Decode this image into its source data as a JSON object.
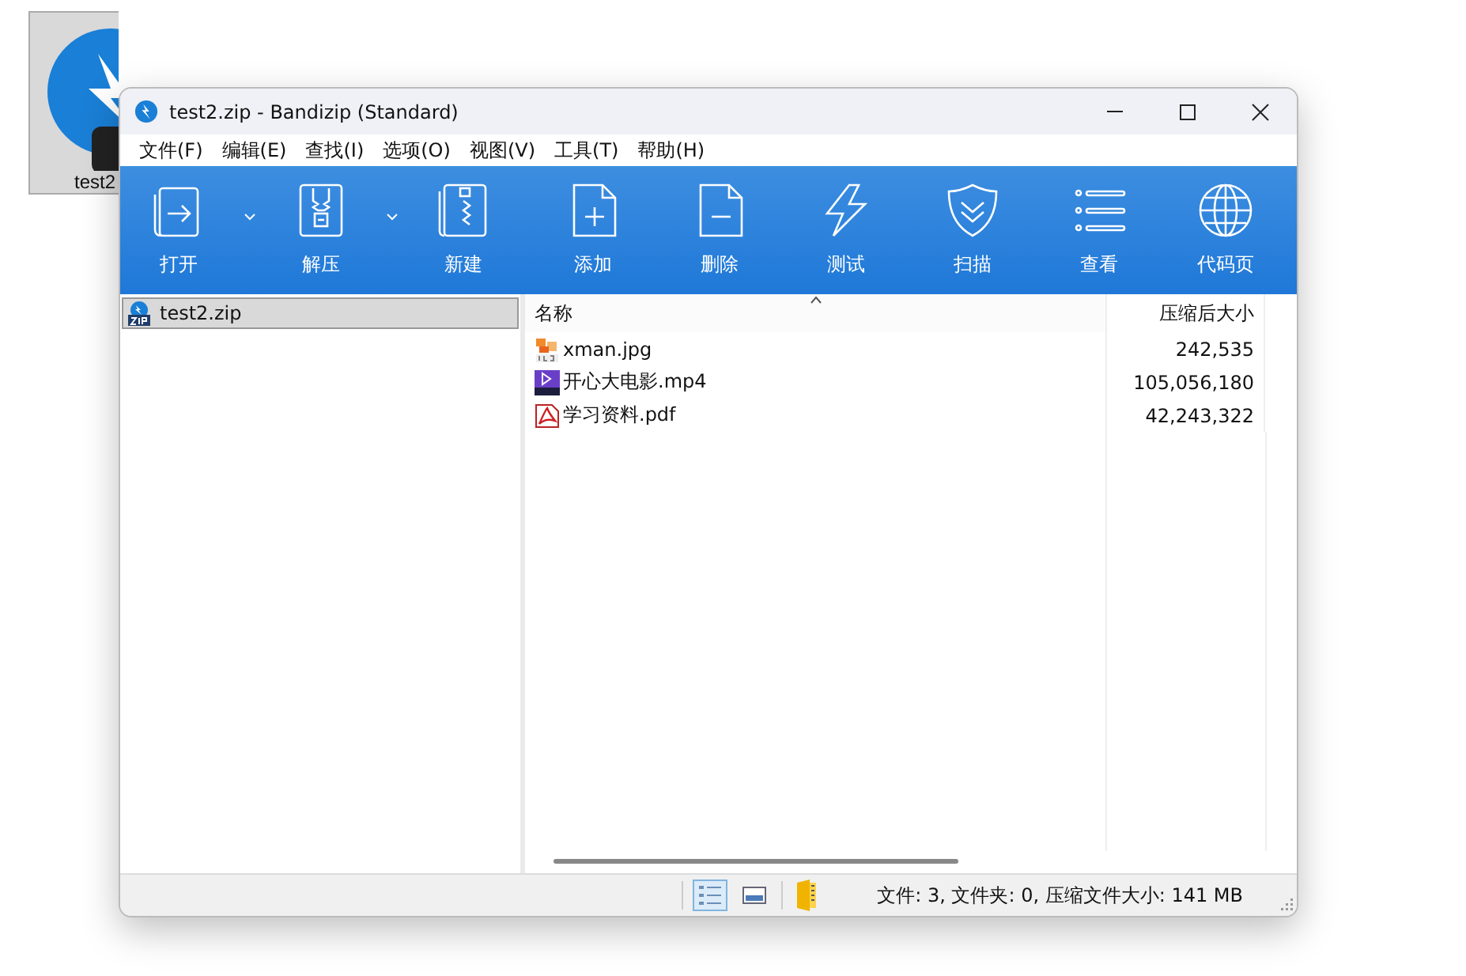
{
  "desktop_icon": {
    "label": "test2",
    "selected": true
  },
  "window": {
    "title": "test2.zip - Bandizip (Standard)"
  },
  "menu": [
    "文件(F)",
    "编辑(E)",
    "查找(I)",
    "选项(O)",
    "视图(V)",
    "工具(T)",
    "帮助(H)"
  ],
  "toolbar": [
    {
      "label": "打开",
      "dropdown": true
    },
    {
      "label": "解压",
      "dropdown": true
    },
    {
      "label": "新建",
      "dropdown": false
    },
    {
      "label": "添加",
      "dropdown": false
    },
    {
      "label": "删除",
      "dropdown": false
    },
    {
      "label": "测试",
      "dropdown": false
    },
    {
      "label": "扫描",
      "dropdown": false
    },
    {
      "label": "查看",
      "dropdown": false
    },
    {
      "label": "代码页",
      "dropdown": false
    }
  ],
  "tree": [
    {
      "label": "test2.zip",
      "selected": true
    }
  ],
  "table": {
    "columns": [
      {
        "label": "名称",
        "sorted": true
      },
      {
        "label": "压缩后大小",
        "sorted": false
      }
    ],
    "rows": [
      {
        "kind": "image",
        "name": "xman.jpg",
        "size": "242,535"
      },
      {
        "kind": "video",
        "name": "开心大电影.mp4",
        "size": "105,056,180"
      },
      {
        "kind": "pdf",
        "name": "学习资料.pdf",
        "size": "42,243,322"
      }
    ]
  },
  "status_bar": {
    "views": [
      {
        "selected": true
      },
      {
        "selected": false
      }
    ],
    "text": "文件: 3, 文件夹: 0, 压缩文件大小: 141 MB"
  }
}
